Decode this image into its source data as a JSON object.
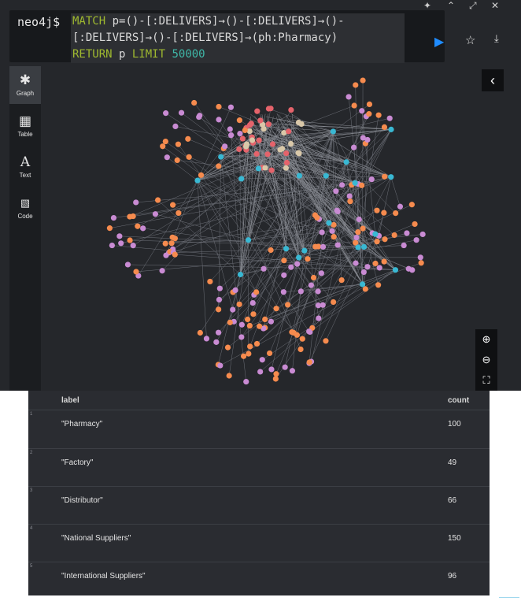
{
  "editor": {
    "prompt": "neo4j$",
    "query_line1_kw": "MATCH",
    "query_line1_rest": " p=()-[:DELIVERS]→()-[:DELIVERS]→()-",
    "query_line2": "[:DELIVERS]→()-[:DELIVERS]→(ph:Pharmacy)",
    "query_line3_kw": "RETURN",
    "query_line3_mid": " p ",
    "query_line3_kw2": "LIMIT",
    "query_line3_num": " 50000",
    "run_icon": "play-icon",
    "favorite_icon": "star-icon",
    "download_icon": "download-icon"
  },
  "sidebar": {
    "tabs": [
      {
        "label": "Graph",
        "icon": "graph-icon"
      },
      {
        "label": "Table",
        "icon": "table-icon"
      },
      {
        "label": "Text",
        "icon": "text-icon"
      },
      {
        "label": "Code",
        "icon": "code-icon"
      }
    ]
  },
  "colors": {
    "pharmacy": "#f68b4e",
    "factory": "#e5636b",
    "distributor": "#39b8d3",
    "national": "#c98bd3",
    "international": "#d9c8a9",
    "accent": "#1f8cff"
  },
  "results": {
    "headers": {
      "label": "label",
      "count": "count"
    },
    "rows": [
      {
        "num": "1",
        "label": "\"Pharmacy\"",
        "count": "100"
      },
      {
        "num": "2",
        "label": "\"Factory\"",
        "count": "49"
      },
      {
        "num": "3",
        "label": "\"Distributor\"",
        "count": "66"
      },
      {
        "num": "4",
        "label": "\"National Suppliers\"",
        "count": "150"
      },
      {
        "num": "5",
        "label": "\"International Suppliers\"",
        "count": "96"
      }
    ]
  }
}
